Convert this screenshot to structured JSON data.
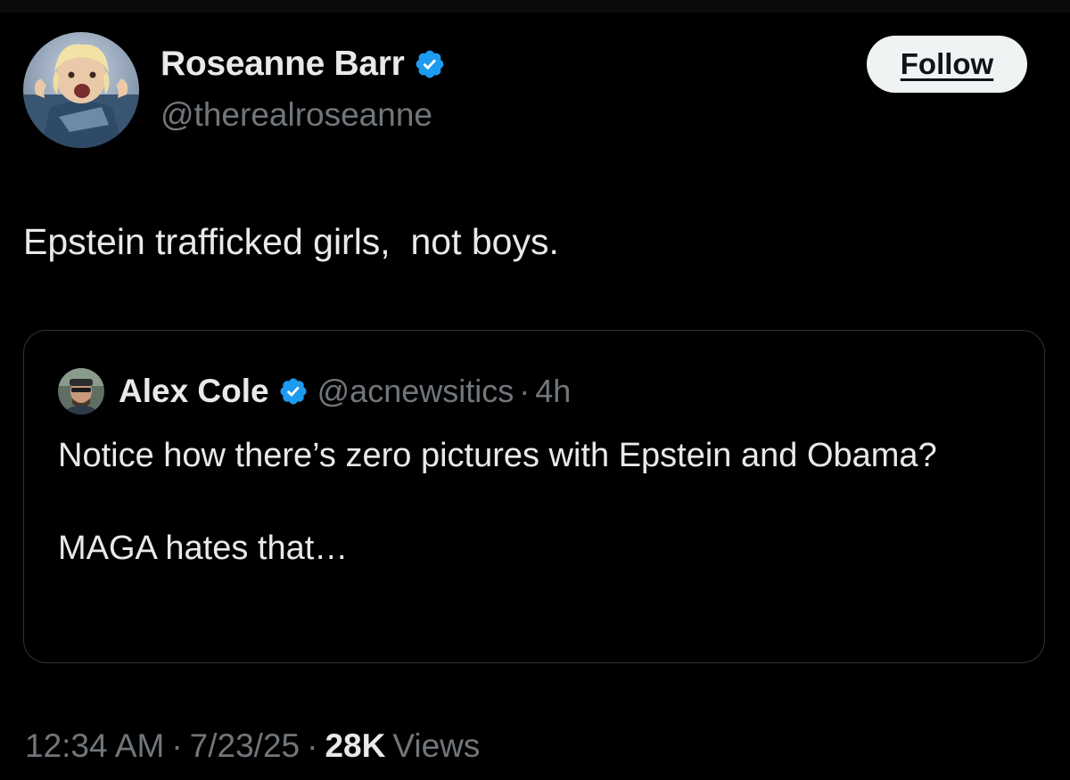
{
  "tweet": {
    "author": {
      "name": "Roseanne Barr",
      "handle": "@therealroseanne",
      "verified": true
    },
    "follow_label": "Follow",
    "text": "Epstein trafficked girls,  not boys.",
    "quoted": {
      "author": {
        "name": "Alex Cole",
        "handle": "@acnewsitics",
        "verified": true
      },
      "separator": "·",
      "time": "4h",
      "paragraphs": [
        "Notice how there’s zero pictures with Epstein and Obama?",
        "MAGA hates that…"
      ]
    },
    "meta": {
      "time": "12:34 AM",
      "separator": "·",
      "date": "7/23/25",
      "views_count": "28K",
      "views_label": "Views"
    }
  },
  "icons": {
    "verified_badge": "verified-badge-icon"
  },
  "colors": {
    "background": "#000000",
    "primary_text": "#e7e9ea",
    "secondary_text": "#71767b",
    "verified_blue": "#1d9bf0",
    "follow_button_bg": "#eff3f4",
    "border": "#2f3336"
  }
}
